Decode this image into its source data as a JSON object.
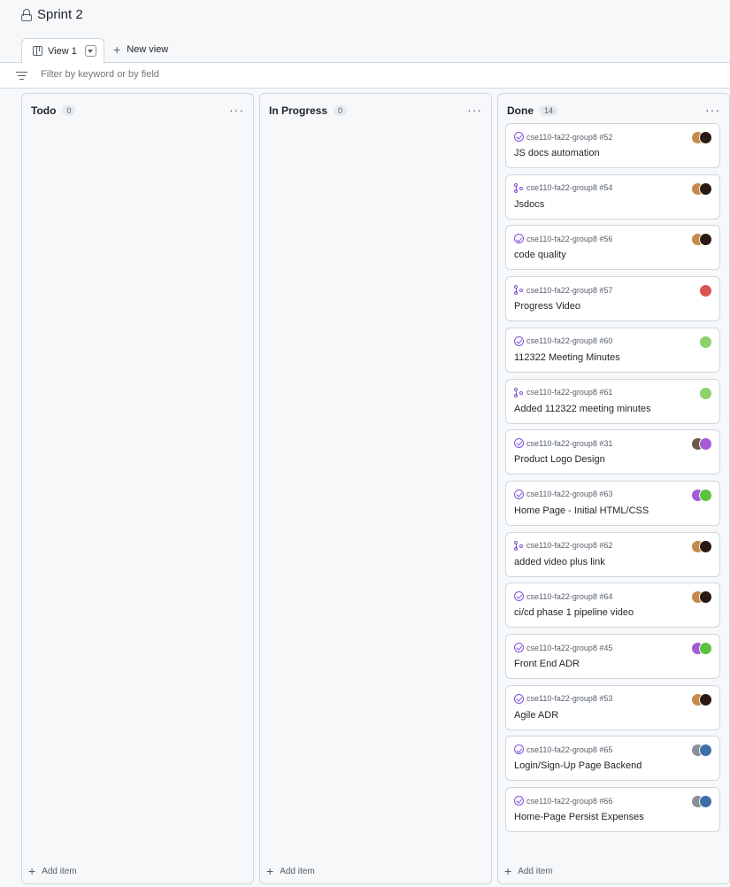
{
  "page": {
    "title": "Sprint 2",
    "lock_icon": "lock-icon"
  },
  "tabs": {
    "active_view": "View 1",
    "new_view": "New view"
  },
  "filter": {
    "placeholder": "Filter by keyword or by field"
  },
  "colors": {
    "merged_purple": "#8250df",
    "border": "#d0d7de",
    "background": "#f6f8fa"
  },
  "columns": [
    {
      "name": "Todo",
      "count": "0",
      "add_item": "Add item"
    },
    {
      "name": "In Progress",
      "count": "0",
      "add_item": "Add item"
    },
    {
      "name": "Done",
      "count": "14",
      "add_item": "Add item"
    }
  ],
  "done_cards": [
    {
      "repo": "cse110-fa22-group8 #52",
      "title": "JS docs automation",
      "type": "issue-closed",
      "avatars": [
        "#c58a4a",
        "#2b1a14"
      ]
    },
    {
      "repo": "cse110-fa22-group8 #54",
      "title": "Jsdocs",
      "type": "pr-merged",
      "avatars": [
        "#c58a4a",
        "#2b1a14"
      ]
    },
    {
      "repo": "cse110-fa22-group8 #56",
      "title": "code quality",
      "type": "issue-closed",
      "avatars": [
        "#c58a4a",
        "#2b1a14"
      ]
    },
    {
      "repo": "cse110-fa22-group8 #57",
      "title": "Progress Video",
      "type": "pr-merged",
      "avatars": [
        "#d9534f"
      ]
    },
    {
      "repo": "cse110-fa22-group8 #60",
      "title": "112322 Meeting Minutes",
      "type": "issue-closed",
      "avatars": [
        "#8fd16a"
      ]
    },
    {
      "repo": "cse110-fa22-group8 #61",
      "title": "Added 112322 meeting minutes",
      "type": "pr-merged",
      "avatars": [
        "#8fd16a"
      ]
    },
    {
      "repo": "cse110-fa22-group8 #31",
      "title": "Product Logo Design",
      "type": "issue-closed",
      "avatars": [
        "#6b5a4a",
        "#a55bd6"
      ]
    },
    {
      "repo": "cse110-fa22-group8 #63",
      "title": "Home Page - Initial HTML/CSS",
      "type": "issue-closed",
      "avatars": [
        "#a55bd6",
        "#5cc13c"
      ]
    },
    {
      "repo": "cse110-fa22-group8 #62",
      "title": "added video plus link",
      "type": "pr-merged",
      "avatars": [
        "#c58a4a",
        "#2b1a14"
      ]
    },
    {
      "repo": "cse110-fa22-group8 #64",
      "title": "ci/cd phase 1 pipeline video",
      "type": "issue-closed",
      "avatars": [
        "#c58a4a",
        "#2b1a14"
      ]
    },
    {
      "repo": "cse110-fa22-group8 #45",
      "title": "Front End ADR",
      "type": "issue-closed",
      "avatars": [
        "#a55bd6",
        "#5cc13c"
      ]
    },
    {
      "repo": "cse110-fa22-group8 #53",
      "title": "Agile ADR",
      "type": "issue-closed",
      "avatars": [
        "#c58a4a",
        "#2b1a14"
      ]
    },
    {
      "repo": "cse110-fa22-group8 #65",
      "title": "Login/Sign-Up Page Backend",
      "type": "issue-closed",
      "avatars": [
        "#8a8f98",
        "#3c6fa8"
      ]
    },
    {
      "repo": "cse110-fa22-group8 #66",
      "title": "Home-Page Persist Expenses",
      "type": "issue-closed",
      "avatars": [
        "#8a8f98",
        "#3c6fa8"
      ]
    }
  ]
}
